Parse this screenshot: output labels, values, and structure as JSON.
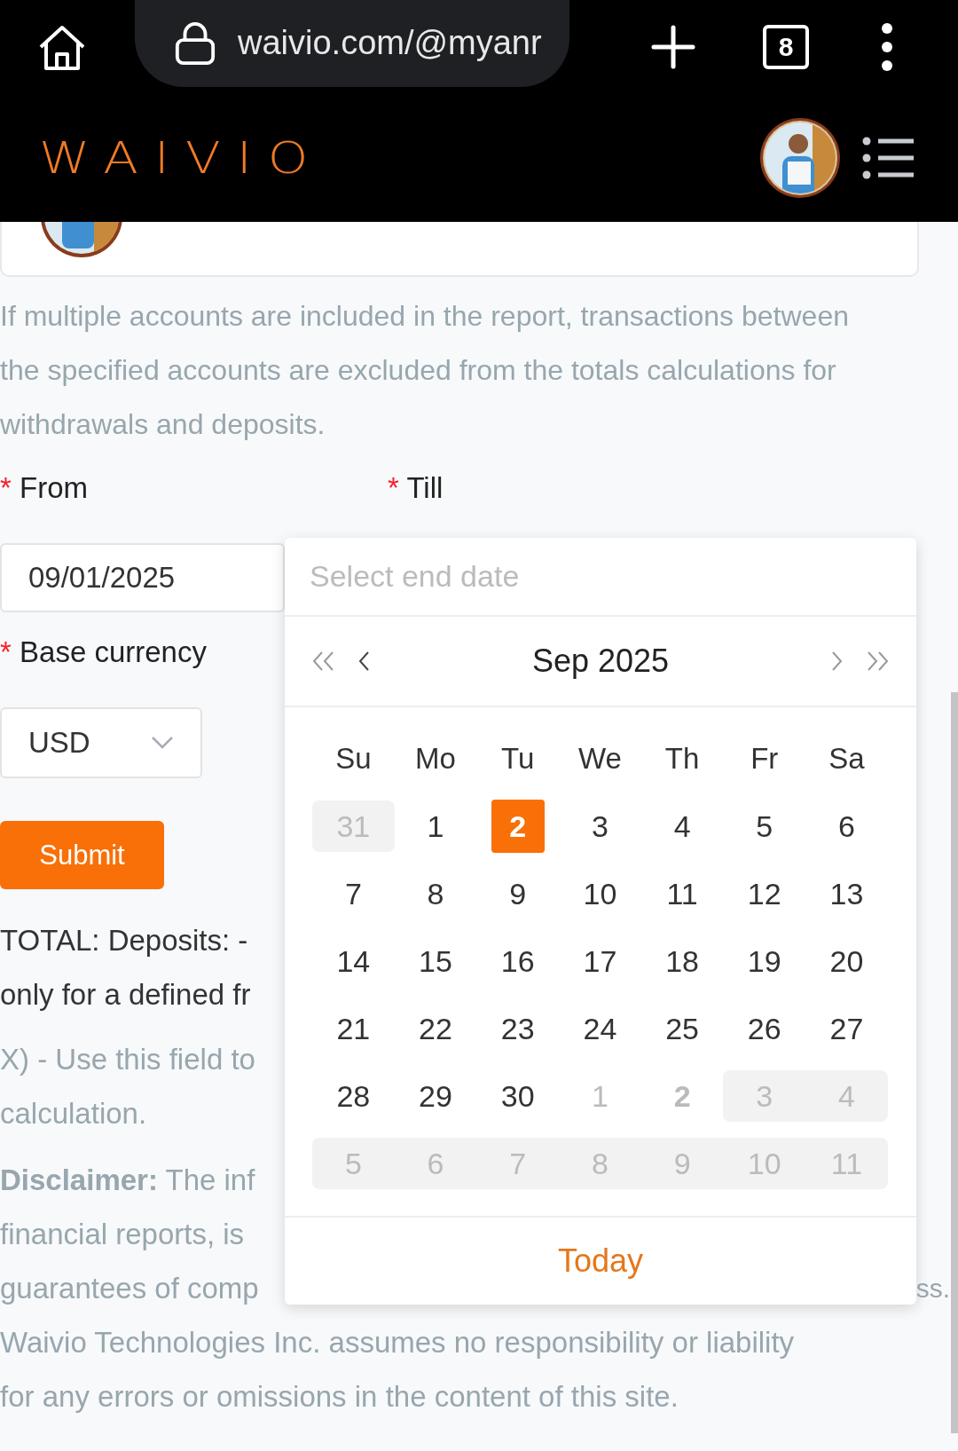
{
  "browser": {
    "url": "waivio.com/@myanr",
    "tab_count": "8"
  },
  "header": {
    "logo": "WAIVIO"
  },
  "intro": "If multiple accounts are included in the report, transactions between the specified accounts are excluded from the totals calculations for withdrawals and deposits.",
  "form": {
    "required_mark": "*",
    "from_label": "From",
    "till_label": "Till",
    "from_value": "09/01/2025",
    "currency_label": "Base currency",
    "currency_value": "USD",
    "submit": "Submit"
  },
  "totals_lines": [
    "TOTAL: Deposits: -",
    "only for a defined fr"
  ],
  "exclude_lines": [
    "X) - Use this field to",
    "calculation."
  ],
  "disclaimer_lines": [
    {
      "text": "**Disclaimer:** The inf"
    },
    {
      "text": "financial reports, is"
    },
    {
      "text": "guarantees of comp",
      "tail": "ss."
    },
    {
      "text": "Waivio Technologies Inc. assumes no responsibility or liability"
    },
    {
      "text": "for any errors or omissions in the content of this site."
    }
  ],
  "date_picker": {
    "placeholder": "Select end date",
    "month": "Sep 2025",
    "weekdays": [
      "Su",
      "Mo",
      "Tu",
      "We",
      "Th",
      "Fr",
      "Sa"
    ],
    "weeks": [
      [
        {
          "day": "31",
          "muted": true,
          "disabled": true,
          "selected": false,
          "today": false
        },
        {
          "day": "1",
          "muted": false,
          "disabled": false,
          "selected": false,
          "today": false
        },
        {
          "day": "2",
          "muted": false,
          "disabled": false,
          "selected": true,
          "today": false
        },
        {
          "day": "3",
          "muted": false,
          "disabled": false,
          "selected": false,
          "today": false
        },
        {
          "day": "4",
          "muted": false,
          "disabled": false,
          "selected": false,
          "today": false
        },
        {
          "day": "5",
          "muted": false,
          "disabled": false,
          "selected": false,
          "today": false
        },
        {
          "day": "6",
          "muted": false,
          "disabled": false,
          "selected": false,
          "today": false
        }
      ],
      [
        {
          "day": "7",
          "muted": false,
          "disabled": false,
          "selected": false,
          "today": false
        },
        {
          "day": "8",
          "muted": false,
          "disabled": false,
          "selected": false,
          "today": false
        },
        {
          "day": "9",
          "muted": false,
          "disabled": false,
          "selected": false,
          "today": false
        },
        {
          "day": "10",
          "muted": false,
          "disabled": false,
          "selected": false,
          "today": false
        },
        {
          "day": "11",
          "muted": false,
          "disabled": false,
          "selected": false,
          "today": false
        },
        {
          "day": "12",
          "muted": false,
          "disabled": false,
          "selected": false,
          "today": false
        },
        {
          "day": "13",
          "muted": false,
          "disabled": false,
          "selected": false,
          "today": false
        }
      ],
      [
        {
          "day": "14",
          "muted": false,
          "disabled": false,
          "selected": false,
          "today": false
        },
        {
          "day": "15",
          "muted": false,
          "disabled": false,
          "selected": false,
          "today": false
        },
        {
          "day": "16",
          "muted": false,
          "disabled": false,
          "selected": false,
          "today": false
        },
        {
          "day": "17",
          "muted": false,
          "disabled": false,
          "selected": false,
          "today": false
        },
        {
          "day": "18",
          "muted": false,
          "disabled": false,
          "selected": false,
          "today": false
        },
        {
          "day": "19",
          "muted": false,
          "disabled": false,
          "selected": false,
          "today": false
        },
        {
          "day": "20",
          "muted": false,
          "disabled": false,
          "selected": false,
          "today": false
        }
      ],
      [
        {
          "day": "21",
          "muted": false,
          "disabled": false,
          "selected": false,
          "today": false
        },
        {
          "day": "22",
          "muted": false,
          "disabled": false,
          "selected": false,
          "today": false
        },
        {
          "day": "23",
          "muted": false,
          "disabled": false,
          "selected": false,
          "today": false
        },
        {
          "day": "24",
          "muted": false,
          "disabled": false,
          "selected": false,
          "today": false
        },
        {
          "day": "25",
          "muted": false,
          "disabled": false,
          "selected": false,
          "today": false
        },
        {
          "day": "26",
          "muted": false,
          "disabled": false,
          "selected": false,
          "today": false
        },
        {
          "day": "27",
          "muted": false,
          "disabled": false,
          "selected": false,
          "today": false
        }
      ],
      [
        {
          "day": "28",
          "muted": false,
          "disabled": false,
          "selected": false,
          "today": false
        },
        {
          "day": "29",
          "muted": false,
          "disabled": false,
          "selected": false,
          "today": false
        },
        {
          "day": "30",
          "muted": false,
          "disabled": false,
          "selected": false,
          "today": false
        },
        {
          "day": "1",
          "muted": true,
          "disabled": false,
          "selected": false,
          "today": false
        },
        {
          "day": "2",
          "muted": true,
          "disabled": false,
          "selected": false,
          "today": true
        },
        {
          "day": "3",
          "muted": true,
          "disabled": true,
          "selected": false,
          "today": false
        },
        {
          "day": "4",
          "muted": true,
          "disabled": true,
          "selected": false,
          "today": false
        }
      ],
      [
        {
          "day": "5",
          "muted": true,
          "disabled": true,
          "selected": false,
          "today": false
        },
        {
          "day": "6",
          "muted": true,
          "disabled": true,
          "selected": false,
          "today": false
        },
        {
          "day": "7",
          "muted": true,
          "disabled": true,
          "selected": false,
          "today": false
        },
        {
          "day": "8",
          "muted": true,
          "disabled": true,
          "selected": false,
          "today": false
        },
        {
          "day": "9",
          "muted": true,
          "disabled": true,
          "selected": false,
          "today": false
        },
        {
          "day": "10",
          "muted": true,
          "disabled": true,
          "selected": false,
          "today": false
        },
        {
          "day": "11",
          "muted": true,
          "disabled": true,
          "selected": false,
          "today": false
        }
      ]
    ],
    "today_link": "Today"
  }
}
